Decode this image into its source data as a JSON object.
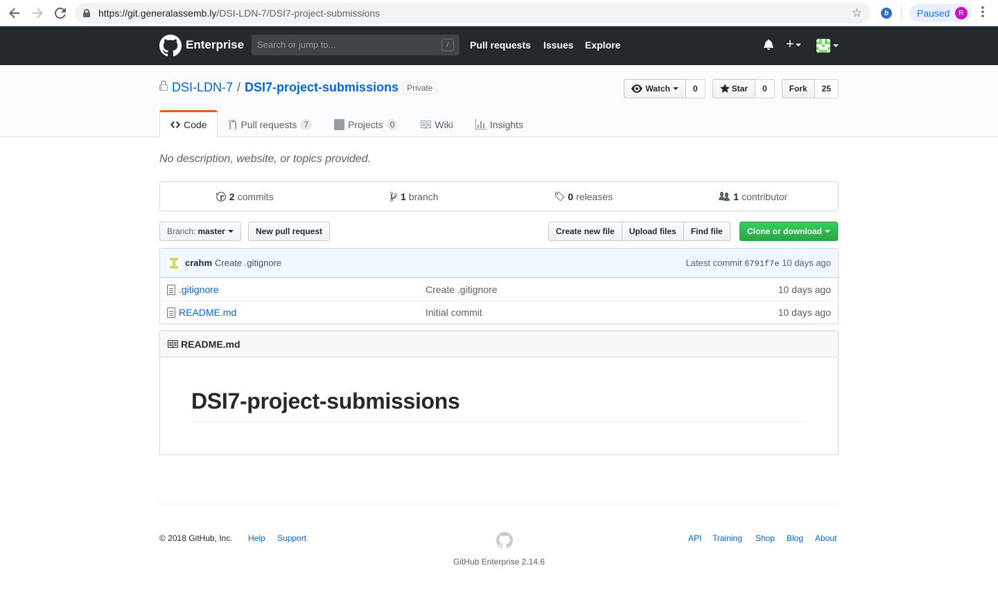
{
  "browser": {
    "url_host": "https://git.generalassemb.ly",
    "url_path": "/DSI-LDN-7/DSI7-project-submissions",
    "profile_status": "Paused",
    "profile_initial": "R",
    "extension_letter": "b"
  },
  "header": {
    "brand": "Enterprise",
    "search_placeholder": "Search or jump to...",
    "search_shortcut": "/",
    "nav": [
      "Pull requests",
      "Issues",
      "Explore"
    ]
  },
  "repo": {
    "owner": "DSI-LDN-7",
    "separator": "/",
    "name": "DSI7-project-submissions",
    "visibility": "Private",
    "watch_label": "Watch",
    "watch_count": "0",
    "star_label": "Star",
    "star_count": "0",
    "fork_label": "Fork",
    "fork_count": "25"
  },
  "tabs": [
    {
      "label": "Code",
      "icon": "code-icon"
    },
    {
      "label": "Pull requests",
      "counter": "7",
      "icon": "pull-request-icon"
    },
    {
      "label": "Projects",
      "counter": "0",
      "icon": "project-icon"
    },
    {
      "label": "Wiki",
      "icon": "book-icon"
    },
    {
      "label": "Insights",
      "icon": "graph-icon"
    }
  ],
  "description": "No description, website, or topics provided.",
  "numbers": [
    {
      "count": "2",
      "label": "commits"
    },
    {
      "count": "1",
      "label": "branch"
    },
    {
      "count": "0",
      "label": "releases"
    },
    {
      "count": "1",
      "label": "contributor"
    }
  ],
  "file_nav": {
    "branch_prefix": "Branch:",
    "branch": "master",
    "new_pr": "New pull request",
    "create_file": "Create new file",
    "upload_files": "Upload files",
    "find_file": "Find file",
    "clone": "Clone or download"
  },
  "latest_commit": {
    "author": "crahm",
    "message": "Create .gitignore",
    "prefix": "Latest commit",
    "sha": "6791f7e",
    "age": "10 days ago"
  },
  "files": [
    {
      "name": ".gitignore",
      "message": "Create .gitignore",
      "age": "10 days ago"
    },
    {
      "name": "README.md",
      "message": "Initial commit",
      "age": "10 days ago"
    }
  ],
  "readme": {
    "filename": "README.md",
    "heading": "DSI7-project-submissions"
  },
  "footer": {
    "copyright": "© 2018 GitHub, Inc.",
    "left_links": [
      "Help",
      "Support"
    ],
    "right_links": [
      "API",
      "Training",
      "Shop",
      "Blog",
      "About"
    ],
    "version": "GitHub Enterprise 2.14.6"
  },
  "colors": {
    "header_bg": "#24292e",
    "link": "#0366d6",
    "clone_green": "#28a745",
    "selected_tab_accent": "#e36209"
  }
}
